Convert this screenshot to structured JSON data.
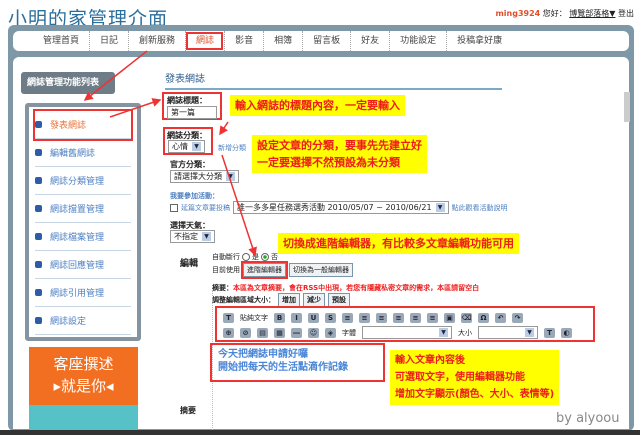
{
  "header": {
    "title": "小明的家管理介面",
    "username": "ming3924",
    "greeting": "您好：",
    "blog_link": "博覽部落格▼",
    "logout": "登出"
  },
  "nav": [
    "管理首頁",
    "日記",
    "創新服務",
    "網誌",
    "影音",
    "相簿",
    "留言板",
    "好友",
    "功能設定",
    "投稿拿好康"
  ],
  "sidebar": {
    "title": "網誌管理功能列表",
    "items": [
      "發表網誌",
      "編輯舊網誌",
      "網誌分類管理",
      "網誌擋置管理",
      "網誌檔案管理",
      "網誌回應管理",
      "網誌引用管理",
      "網誌設定"
    ]
  },
  "ad": {
    "line1": "客座撰述",
    "line2": "▸就是你◂"
  },
  "form": {
    "page_title": "發表網誌",
    "title_label": "網誌標題：",
    "title_value": "第一篇",
    "category_label": "網誌分類：",
    "category_value": "心情",
    "add_category": "新增分類",
    "official_label": "官方分類：",
    "official_value": "請選擇大分類",
    "event_label": "我要參加活動：",
    "event_checkbox": "延篇文章要投稿",
    "event_value": "誰一多多星任務選秀活動 2010/05/07 ~ 2010/06/21",
    "event_link": "點此觀看活動說明",
    "weather_label": "選擇天氣：",
    "weather_value": "不指定",
    "edit_label": "編輯",
    "autobreak_label": "自動斷行",
    "yes": "是",
    "no": "否",
    "current_label": "目前使用",
    "advanced_editor": "進階編輯器",
    "switch_basic": "切換為一般編輯器",
    "summary_note_label": "摘要：",
    "summary_note": "本區為文章摘要，會在RSS中出現，若您有隱藏私密文章的需求，本區請留空白",
    "resize_label": "調整編輯區域大小：",
    "increase": "增加",
    "decrease": "減少",
    "default": "預設",
    "toolbar_paste": "貼純文字",
    "font_label": "字體",
    "size_label": "大小",
    "content_line1": "今天把網誌申請好囉",
    "content_line2": "開始把每天的生活點滴作記錄",
    "summary_label": "摘要"
  },
  "notes": {
    "n1": "輸入網誌的標題內容，一定要輸入",
    "n2a": "設定文章的分類，要事先先建立好",
    "n2b": "一定要選擇不然預設為未分類",
    "n3": "切換成進階編輯器，有比較多文章編輯功能可用",
    "n4a": "輸入文章內容後",
    "n4b": "可選取文字，使用編輯器功能",
    "n4c": "增加文字顯示(顏色、大小、表情等)"
  },
  "signature": "by alyoou"
}
